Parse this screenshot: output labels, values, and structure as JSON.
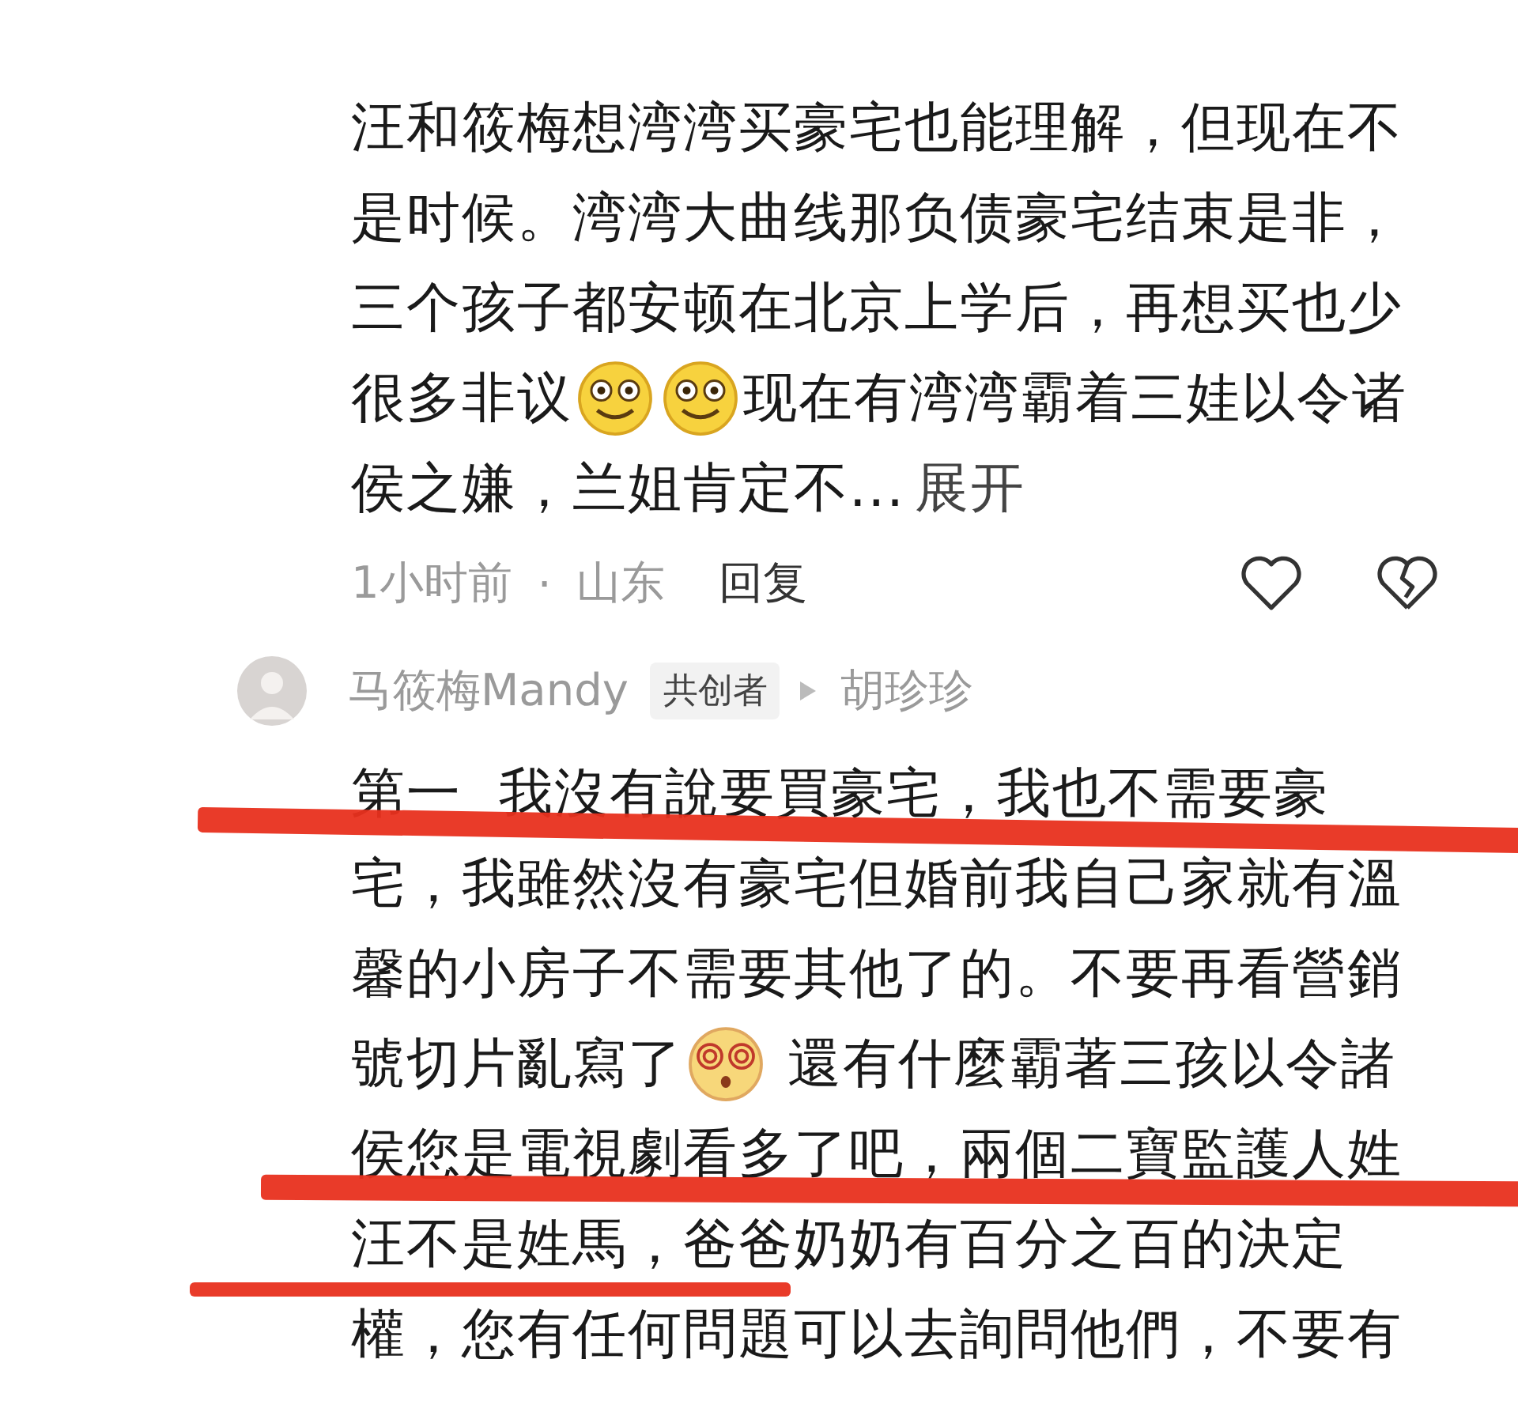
{
  "comment": {
    "lines": [
      [
        {
          "kind": "text",
          "text": "汪和筱梅想湾湾买豪宅也能理解，但现在不"
        }
      ],
      [
        {
          "kind": "text",
          "text": "是时候。湾湾大曲线那负债豪宅结束是非，"
        }
      ],
      [
        {
          "kind": "text",
          "text": "三个孩子都安顿在北京上学后，再想买也少"
        }
      ],
      [
        {
          "kind": "text",
          "text": "很多非议"
        },
        {
          "kind": "emoji_smile"
        },
        {
          "kind": "emoji_smile"
        },
        {
          "kind": "text",
          "text": "现在有湾湾霸着三娃以令诸"
        }
      ],
      [
        {
          "kind": "text",
          "text": "侯之嫌，兰姐肯定不..."
        },
        {
          "kind": "link",
          "text": "展开"
        }
      ]
    ],
    "time": "1小时前",
    "separator": "·",
    "location": "山东",
    "reply": "回复"
  },
  "reply": {
    "author": "马筱梅Mandy",
    "badge": "共创者",
    "reply_to": "胡珍珍",
    "lines": [
      [
        {
          "kind": "text",
          "text": "第一  我沒有說要買豪宅，我也不需要豪"
        }
      ],
      [
        {
          "kind": "text",
          "text": "宅，我雖然沒有豪宅但婚前我自己家就有溫"
        }
      ],
      [
        {
          "kind": "text",
          "text": "馨的小房子不需要其他了的。不要再看營銷"
        }
      ],
      [
        {
          "kind": "text",
          "text": "號切片亂寫了"
        },
        {
          "kind": "emoji_dizzy"
        },
        {
          "kind": "text",
          "text": " 還有什麼霸著三孩以令諸"
        }
      ],
      [
        {
          "kind": "text",
          "text": "侯您是電視劇看多了吧，兩個二寶監護人姓"
        }
      ],
      [
        {
          "kind": "text",
          "text": "汪不是姓馬，爸爸奶奶有百分之百的決定"
        }
      ],
      [
        {
          "kind": "text",
          "text": "權，您有任何問題可以去詢問他們，不要有"
        }
      ]
    ]
  }
}
